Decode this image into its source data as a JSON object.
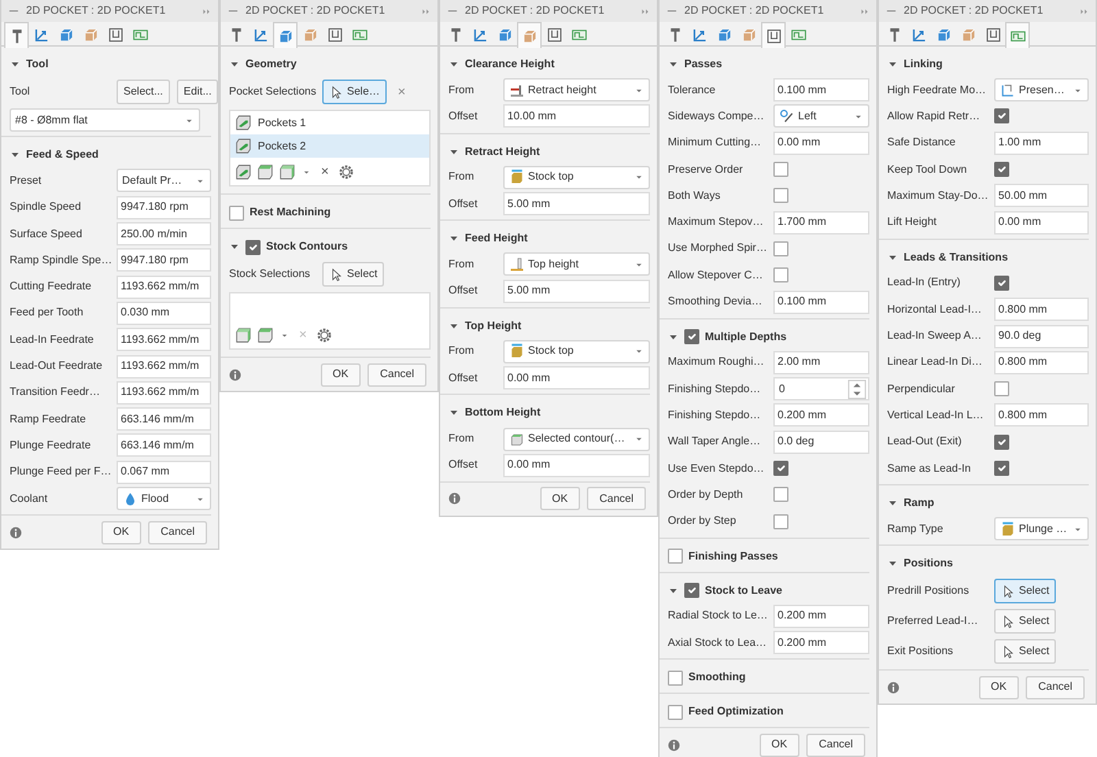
{
  "panels": [
    {
      "title": "2D POCKET : 2D POCKET1",
      "tabs": [
        {
          "kind": "tool",
          "selected": true
        },
        {
          "kind": "axes",
          "selected": false
        },
        {
          "kind": "geometry",
          "selected": false
        },
        {
          "kind": "heights",
          "selected": false
        },
        {
          "kind": "passes",
          "selected": false
        },
        {
          "kind": "linking",
          "selected": false
        }
      ],
      "sections": [
        {
          "title": "Tool",
          "expanded": true,
          "rows": [
            {
              "kind": "buttons",
              "label": "Tool",
              "buttons": [
                "Select...",
                "Edit..."
              ]
            },
            {
              "kind": "dropdown",
              "value": "#8 - Ø8mm flat"
            }
          ]
        },
        {
          "title": "Feed & Speed",
          "expanded": true,
          "rows": [
            {
              "kind": "dropdown",
              "label": "Preset",
              "value": "Default Pr…"
            },
            {
              "kind": "field",
              "label": "Spindle Speed",
              "value": "9947.180 rpm"
            },
            {
              "kind": "field",
              "label": "Surface Speed",
              "value": "250.00 m/min"
            },
            {
              "kind": "field",
              "label": "Ramp Spindle Spe…",
              "value": "9947.180 rpm"
            },
            {
              "kind": "field",
              "label": "Cutting Feedrate",
              "value": "1193.662 mm/m"
            },
            {
              "kind": "field",
              "label": "Feed per Tooth",
              "value": "0.030 mm"
            },
            {
              "kind": "field",
              "label": "Lead-In Feedrate",
              "value": "1193.662 mm/m"
            },
            {
              "kind": "field",
              "label": "Lead-Out Feedrate",
              "value": "1193.662 mm/m"
            },
            {
              "kind": "field",
              "label": "Transition Feedr…",
              "value": "1193.662 mm/m"
            },
            {
              "kind": "field",
              "label": "Ramp Feedrate",
              "value": "663.146 mm/m"
            },
            {
              "kind": "field",
              "label": "Plunge Feedrate",
              "value": "663.146 mm/m"
            },
            {
              "kind": "field",
              "label": "Plunge Feed per F…",
              "value": "0.067 mm"
            },
            {
              "kind": "dropdown",
              "label": "Coolant",
              "option": {
                "kind": "drop",
                "text": "Flood"
              }
            }
          ]
        }
      ],
      "buttons": [
        "OK",
        "Cancel"
      ]
    },
    {
      "title": "2D POCKET : 2D POCKET1",
      "tabs": [
        {
          "kind": "tool",
          "selected": false
        },
        {
          "kind": "axes",
          "selected": false
        },
        {
          "kind": "geometry",
          "selected": true
        },
        {
          "kind": "heights",
          "selected": false
        },
        {
          "kind": "passes",
          "selected": false
        },
        {
          "kind": "linking",
          "selected": false
        }
      ],
      "sections": [
        {
          "title": "Geometry",
          "expanded": true,
          "rows": [
            {
              "kind": "select",
              "label": "Pocket Selections",
              "button": "Sele…",
              "selected": true,
              "clear": "×"
            },
            {
              "kind": "list",
              "items": [
                {
                  "label": "Pockets 1",
                  "selected": false
                },
                {
                  "label": "Pockets 2",
                  "selected": true
                }
              ],
              "toolbar": [
                {
                  "kind": "face"
                },
                {
                  "kind": "box"
                },
                {
                  "kind": "solid"
                },
                {
                  "kind": "caret"
                },
                {
                  "kind": "remove",
                  "label": "×",
                  "disabled": false
                },
                {
                  "kind": "gear"
                }
              ]
            }
          ]
        },
        {
          "title": "Rest Machining",
          "expanded": false,
          "checked": false
        },
        {
          "title": "Stock Contours",
          "expanded": true,
          "checked": true,
          "rows": [
            {
              "kind": "select",
              "label": "Stock Selections",
              "button": "Select",
              "selected": false
            },
            {
              "kind": "list",
              "items": [],
              "toolbar": [
                {
                  "kind": "solid"
                },
                {
                  "kind": "box"
                },
                {
                  "kind": "caret"
                },
                {
                  "kind": "remove",
                  "label": "×",
                  "disabled": true
                },
                {
                  "kind": "gear"
                }
              ]
            }
          ]
        }
      ],
      "buttons": [
        "OK",
        "Cancel"
      ]
    },
    {
      "title": "2D POCKET : 2D POCKET1",
      "tabs": [
        {
          "kind": "tool",
          "selected": false
        },
        {
          "kind": "axes",
          "selected": false
        },
        {
          "kind": "geometry",
          "selected": false
        },
        {
          "kind": "heights",
          "selected": true
        },
        {
          "kind": "passes",
          "selected": false
        },
        {
          "kind": "linking",
          "selected": false
        }
      ],
      "sections": [
        {
          "title": "Clearance Height",
          "expanded": true,
          "rows": [
            {
              "kind": "dropdown",
              "label": "From",
              "option": {
                "kind": "retract",
                "text": "Retract height"
              }
            },
            {
              "kind": "field",
              "label": "Offset",
              "value": "10.00 mm"
            }
          ]
        },
        {
          "title": "Retract Height",
          "expanded": true,
          "rows": [
            {
              "kind": "dropdown",
              "label": "From",
              "option": {
                "kind": "stock",
                "text": "Stock top"
              }
            },
            {
              "kind": "field",
              "label": "Offset",
              "value": "5.00 mm"
            }
          ]
        },
        {
          "title": "Feed Height",
          "expanded": true,
          "rows": [
            {
              "kind": "dropdown",
              "label": "From",
              "option": {
                "kind": "top",
                "text": "Top height"
              }
            },
            {
              "kind": "field",
              "label": "Offset",
              "value": "5.00 mm"
            }
          ]
        },
        {
          "title": "Top Height",
          "expanded": true,
          "rows": [
            {
              "kind": "dropdown",
              "label": "From",
              "option": {
                "kind": "stock",
                "text": "Stock top"
              }
            },
            {
              "kind": "field",
              "label": "Offset",
              "value": "0.00 mm"
            }
          ]
        },
        {
          "title": "Bottom Height",
          "expanded": true,
          "rows": [
            {
              "kind": "dropdown",
              "label": "From",
              "option": {
                "kind": "contour",
                "text": "Selected contour(…"
              }
            },
            {
              "kind": "field",
              "label": "Offset",
              "value": "0.00 mm"
            }
          ]
        }
      ],
      "buttons": [
        "OK",
        "Cancel"
      ]
    },
    {
      "title": "2D POCKET : 2D POCKET1",
      "tabs": [
        {
          "kind": "tool",
          "selected": false
        },
        {
          "kind": "axes",
          "selected": false
        },
        {
          "kind": "geometry",
          "selected": false
        },
        {
          "kind": "heights",
          "selected": false
        },
        {
          "kind": "passes",
          "selected": true
        },
        {
          "kind": "linking",
          "selected": false
        }
      ],
      "sections": [
        {
          "title": "Passes",
          "expanded": true,
          "rows": [
            {
              "kind": "field",
              "label": "Tolerance",
              "value": "0.100 mm"
            },
            {
              "kind": "dropdown",
              "label": "Sideways Compe…",
              "option": {
                "kind": "compensation",
                "text": "Left"
              }
            },
            {
              "kind": "field",
              "label": "Minimum Cutting…",
              "value": "0.00 mm"
            },
            {
              "kind": "checkbox",
              "label": "Preserve Order",
              "checked": false
            },
            {
              "kind": "checkbox",
              "label": "Both Ways",
              "checked": false
            },
            {
              "kind": "field",
              "label": "Maximum Stepov…",
              "value": "1.700 mm"
            },
            {
              "kind": "checkbox",
              "label": "Use Morphed Spir…",
              "checked": false
            },
            {
              "kind": "checkbox",
              "label": "Allow Stepover C…",
              "checked": false
            },
            {
              "kind": "field",
              "label": "Smoothing Devia…",
              "value": "0.100 mm"
            }
          ]
        },
        {
          "title": "Multiple Depths",
          "expanded": true,
          "checked": true,
          "rows": [
            {
              "kind": "field",
              "label": "Maximum Roughi…",
              "value": "2.00 mm"
            },
            {
              "kind": "spinner",
              "label": "Finishing Stepdo…",
              "value": "0"
            },
            {
              "kind": "field",
              "label": "Finishing Stepdo…",
              "value": "0.200 mm"
            },
            {
              "kind": "field",
              "label": "Wall Taper Angle…",
              "value": "0.0 deg"
            },
            {
              "kind": "checkbox",
              "label": "Use Even Stepdo…",
              "checked": true
            },
            {
              "kind": "checkbox",
              "label": "Order by Depth",
              "checked": false
            },
            {
              "kind": "checkbox",
              "label": "Order by Step",
              "checked": false
            }
          ]
        },
        {
          "title": "Finishing Passes",
          "expanded": false,
          "checked": false
        },
        {
          "title": "Stock to Leave",
          "expanded": true,
          "checked": true,
          "rows": [
            {
              "kind": "field",
              "label": "Radial Stock to Le…",
              "value": "0.200 mm"
            },
            {
              "kind": "field",
              "label": "Axial Stock to Lea…",
              "value": "0.200 mm"
            }
          ]
        },
        {
          "title": "Smoothing",
          "expanded": false,
          "checked": false
        },
        {
          "title": "Feed Optimization",
          "expanded": false,
          "checked": false
        }
      ],
      "buttons": [
        "OK",
        "Cancel"
      ]
    },
    {
      "title": "2D POCKET : 2D POCKET1",
      "tabs": [
        {
          "kind": "tool",
          "selected": false
        },
        {
          "kind": "axes",
          "selected": false
        },
        {
          "kind": "geometry",
          "selected": false
        },
        {
          "kind": "heights",
          "selected": false
        },
        {
          "kind": "passes",
          "selected": false
        },
        {
          "kind": "linking",
          "selected": true
        }
      ],
      "sections": [
        {
          "title": "Linking",
          "expanded": true,
          "rows": [
            {
              "kind": "dropdown",
              "label": "High Feedrate Mo…",
              "option": {
                "kind": "linkpath",
                "text": "Presen…"
              }
            },
            {
              "kind": "checkbox",
              "label": "Allow Rapid Retr…",
              "checked": true
            },
            {
              "kind": "field",
              "label": "Safe Distance",
              "value": "1.00 mm"
            },
            {
              "kind": "checkbox",
              "label": "Keep Tool Down",
              "checked": true
            },
            {
              "kind": "field",
              "label": "Maximum Stay-Do…",
              "value": "50.00 mm"
            },
            {
              "kind": "field",
              "label": "Lift Height",
              "value": "0.00 mm"
            }
          ]
        },
        {
          "title": "Leads & Transitions",
          "expanded": true,
          "rows": [
            {
              "kind": "checkbox",
              "label": "Lead-In (Entry)",
              "checked": true
            },
            {
              "kind": "field",
              "label": "Horizontal Lead-I…",
              "value": "0.800 mm"
            },
            {
              "kind": "field",
              "label": "Lead-In Sweep A…",
              "value": "90.0 deg"
            },
            {
              "kind": "field",
              "label": "Linear Lead-In Di…",
              "value": "0.800 mm"
            },
            {
              "kind": "checkbox",
              "label": "Perpendicular",
              "checked": false
            },
            {
              "kind": "field",
              "label": "Vertical Lead-In L…",
              "value": "0.800 mm"
            },
            {
              "kind": "checkbox",
              "label": "Lead-Out (Exit)",
              "checked": true
            },
            {
              "kind": "checkbox",
              "label": "Same as Lead-In",
              "checked": true
            }
          ]
        },
        {
          "title": "Ramp",
          "expanded": true,
          "rows": [
            {
              "kind": "dropdown",
              "label": "Ramp Type",
              "option": {
                "kind": "stock",
                "text": "Plunge …"
              }
            }
          ]
        },
        {
          "title": "Positions",
          "expanded": true,
          "rows": [
            {
              "kind": "select",
              "label": "Predrill Positions",
              "button": "Select",
              "selected": true
            },
            {
              "kind": "select",
              "label": "Preferred Lead-I…",
              "button": "Select",
              "selected": false
            },
            {
              "kind": "select",
              "label": "Exit Positions",
              "button": "Select",
              "selected": false
            }
          ]
        }
      ],
      "buttons": [
        "OK",
        "Cancel"
      ]
    }
  ]
}
